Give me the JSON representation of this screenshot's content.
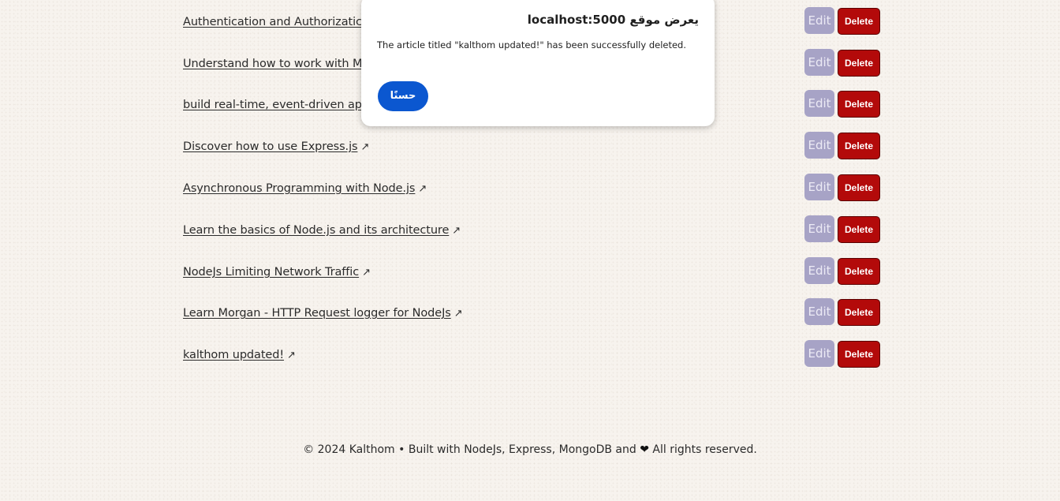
{
  "articles": [
    {
      "title": "Authentication and Authorizatic",
      "edit_label": "Edit",
      "delete_label": "Delete"
    },
    {
      "title": "Understand how to work with M",
      "edit_label": "Edit",
      "delete_label": "Delete"
    },
    {
      "title": "build real-time, event-driven ap",
      "edit_label": "Edit",
      "delete_label": "Delete"
    },
    {
      "title": "Discover how to use Express.js",
      "edit_label": "Edit",
      "delete_label": "Delete"
    },
    {
      "title": "Asynchronous Programming with Node.js",
      "edit_label": "Edit",
      "delete_label": "Delete"
    },
    {
      "title": "Learn the basics of Node.js and its architecture",
      "edit_label": "Edit",
      "delete_label": "Delete"
    },
    {
      "title": "NodeJs Limiting Network Traffic",
      "edit_label": "Edit",
      "delete_label": "Delete"
    },
    {
      "title": "Learn Morgan - HTTP Request logger for NodeJs",
      "edit_label": "Edit",
      "delete_label": "Delete"
    },
    {
      "title": "kalthom updated!",
      "edit_label": "Edit",
      "delete_label": "Delete"
    }
  ],
  "link_icon": "external-link-arrow-icon",
  "link_arrow": "↗",
  "footer": {
    "text_before": "© 2024 Kalthom • Built with NodeJs, Express, MongoDB and",
    "heart_icon": "heart-icon",
    "heart": "❤",
    "text_after": "All rights reserved."
  },
  "dialog": {
    "title": "يعرض موقع localhost:5000",
    "message": "The article titled \"kalthom updated!\" has been successfully deleted.",
    "ok_label": "حسنًا"
  },
  "colors": {
    "background": "#f7f3ee",
    "edit_button": "#a7a3c6",
    "delete_button": "#b30a0a",
    "dialog_button": "#0b57d0"
  }
}
